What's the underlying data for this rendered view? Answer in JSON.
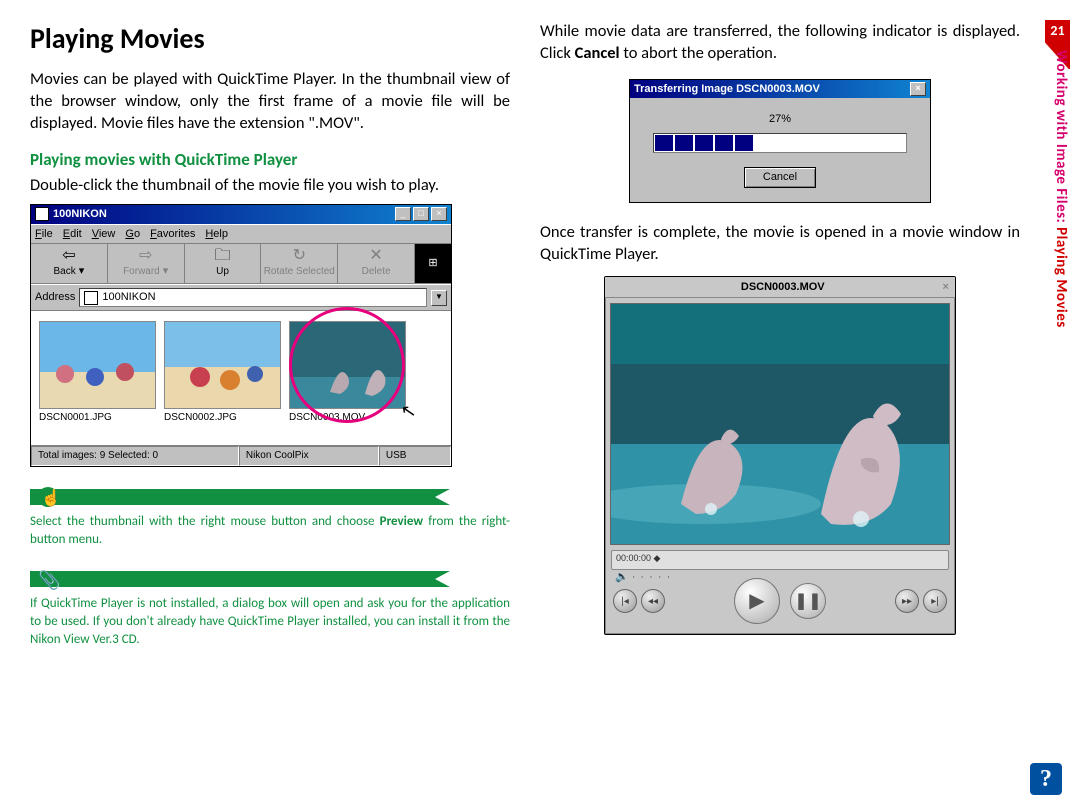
{
  "page_number": "21",
  "side_label_pink": "Working with Image Files: ",
  "side_label_red": "Playing Movies",
  "left": {
    "heading": "Playing Movies",
    "intro": "Movies can be played with QuickTime Player.  In the thumbnail view of the browser window, only the first frame of a movie file will be displayed.  Movie files have the extension \".MOV\".",
    "subhead": "Playing movies with QuickTime Player",
    "subtext": "Double-click the thumbnail of the movie file you wish to play.",
    "tip1_a": "Select the thumbnail with the right mouse button and choose ",
    "tip1_b": "Preview",
    "tip1_c": " from the right-button menu.",
    "tip2": "If QuickTime Player is not installed, a dialog box will open and ask you for the application to be used.  If you don't already have QuickTime Player installed, you can install it from the Nikon View Ver.3 CD."
  },
  "browser": {
    "title": "100NIKON",
    "menus": [
      "File",
      "Edit",
      "View",
      "Go",
      "Favorites",
      "Help"
    ],
    "tools": {
      "back": "Back",
      "forward": "Forward",
      "up": "Up",
      "rotate": "Rotate Selected",
      "delete": "Delete"
    },
    "address_label": "Address",
    "address_value": "100NIKON",
    "thumbs": [
      "DSCN0001.JPG",
      "DSCN0002.JPG",
      "DSCN0003.MOV"
    ],
    "status": {
      "total": "Total images: 9   Selected: 0",
      "device": "Nikon CoolPix",
      "conn": "USB"
    }
  },
  "right": {
    "p1_a": "While movie data are transferred, the following indicator is displayed.  Click ",
    "p1_b": "Cancel",
    "p1_c": " to abort the operation.",
    "p2": "Once transfer is complete, the movie is opened in a movie window in QuickTime Player."
  },
  "dialog": {
    "title": "Transferring Image DSCN0003.MOV",
    "percent": "27%",
    "button": "Cancel"
  },
  "qt": {
    "title": "DSCN0003.MOV",
    "time": "00:00:00"
  }
}
